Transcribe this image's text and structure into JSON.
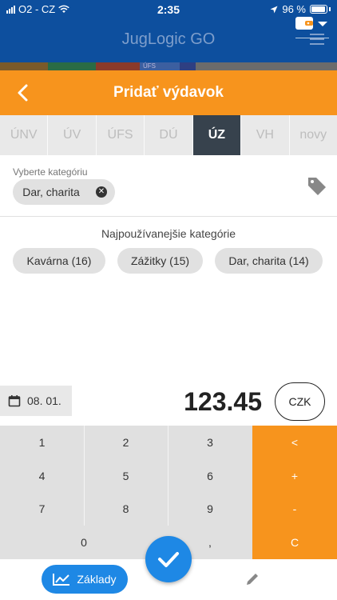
{
  "status": {
    "carrier": "O2 - CZ",
    "time": "2:35",
    "battery": "96 %"
  },
  "app": {
    "title": "JugLogic GO"
  },
  "colorstrip": [
    {
      "color": "#7a5a2a",
      "label": ""
    },
    {
      "color": "#2a6b45",
      "label": ""
    },
    {
      "color": "#8a3a2a",
      "label": ""
    },
    {
      "color": "#3c5fa0",
      "label": "ÚFS"
    },
    {
      "color": "#2e3f82",
      "label": ""
    },
    {
      "color": "#6b6b6b",
      "label": ""
    }
  ],
  "header": {
    "title": "Pridať výdavok"
  },
  "tabs": [
    {
      "label": "ÚNV",
      "active": false
    },
    {
      "label": "ÚV",
      "active": false
    },
    {
      "label": "ÚFS",
      "active": false
    },
    {
      "label": "DÚ",
      "active": false
    },
    {
      "label": "ÚZ",
      "active": true
    },
    {
      "label": "VH",
      "active": false
    },
    {
      "label": "novy",
      "active": false
    }
  ],
  "category": {
    "label": "Vyberte kategóriu",
    "selected": "Dar, charita",
    "most_used_label": "Najpoužívanejšie kategórie",
    "most_used": [
      "Kavárna (16)",
      "Zážitky (15)",
      "Dar, charita (14)"
    ]
  },
  "entry": {
    "date": "08. 01.",
    "amount": "123.45",
    "currency": "CZK"
  },
  "keypad": {
    "numbers": [
      "1",
      "2",
      "3",
      "4",
      "5",
      "6",
      "7",
      "8",
      "9",
      "0",
      ","
    ],
    "ops": [
      "<",
      "+",
      "-",
      "C"
    ]
  },
  "nav": {
    "basics": "Základy"
  },
  "colors": {
    "accent": "#f7941d",
    "primary": "#0d4f9e",
    "button": "#1e88e5",
    "active_tab": "#37424d"
  }
}
